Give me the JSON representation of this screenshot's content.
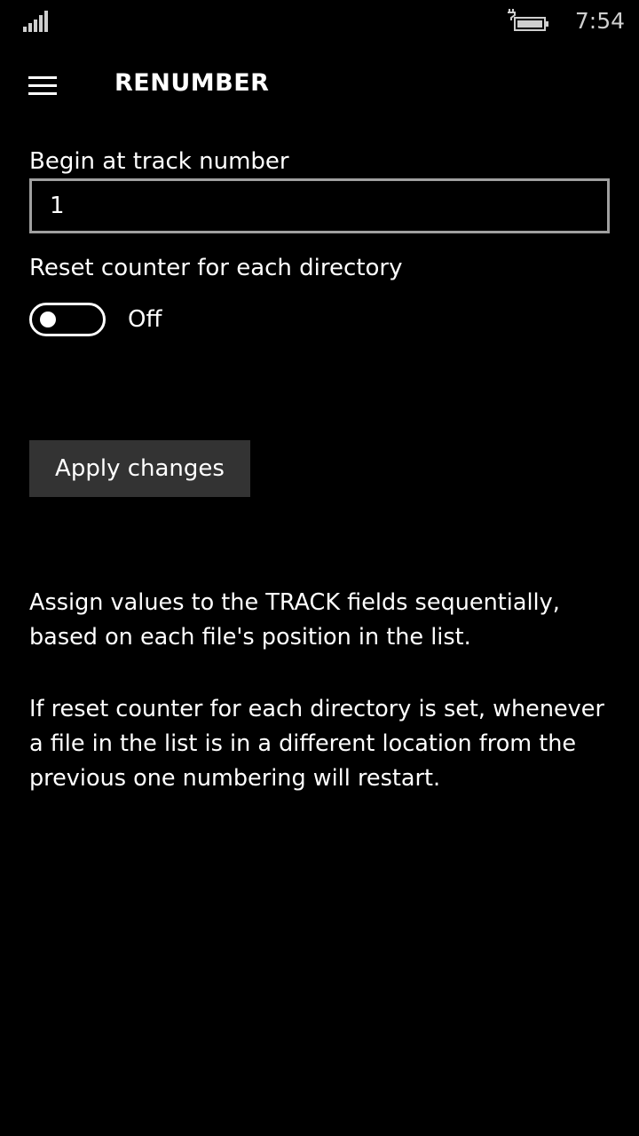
{
  "status_bar": {
    "time": "7:54"
  },
  "header": {
    "title": "RENUMBER"
  },
  "form": {
    "begin_label": "Begin at track number",
    "begin_value": "1",
    "reset_label": "Reset counter for each directory",
    "reset_state": "Off",
    "apply_label": "Apply changes"
  },
  "description": {
    "paragraph1": "Assign values to the TRACK fields sequentially, based on each file's position in the list.",
    "paragraph2": "If reset counter for each directory is set, whenever a file in the list is in a different location from the previous one numbering will restart."
  },
  "colors": {
    "background": "#000000",
    "text": "#ffffff",
    "input_border": "#a0a0a0",
    "button_bg": "#333333"
  },
  "icons": {
    "signal": "signal-strength-icon",
    "battery": "battery-charging-icon",
    "menu": "hamburger-menu-icon"
  }
}
